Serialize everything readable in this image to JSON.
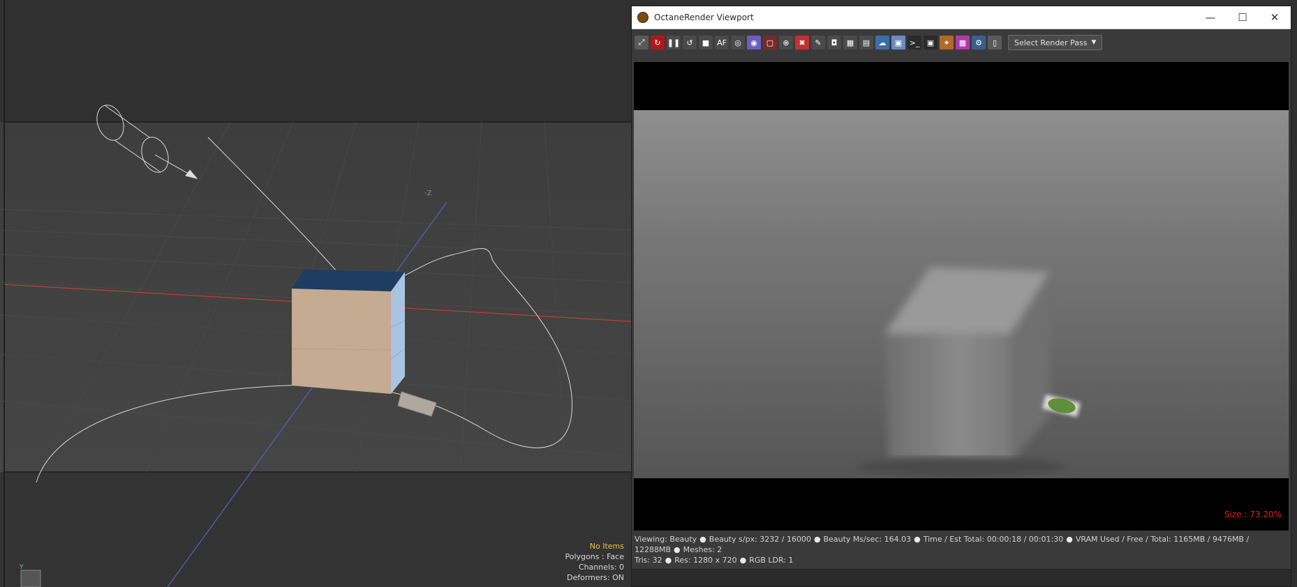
{
  "viewport": {
    "axis_label": "-Z",
    "info": {
      "selection": "No Items",
      "polygons": "Polygons : Face",
      "channels": "Channels: 0",
      "deformers": "Deformers: ON"
    },
    "gizmo_axis": "Y"
  },
  "octane": {
    "title": "OctaneRender Viewport",
    "controls": {
      "minimize": "—",
      "maximize": "☐",
      "close": "✕"
    },
    "toolbar": {
      "tools": [
        {
          "name": "expand-icon",
          "color": "#5a5a5a",
          "glyph": "⤢"
        },
        {
          "name": "start-render-icon",
          "color": "#b01818",
          "glyph": "↻"
        },
        {
          "name": "pause-icon",
          "color": "#4a4a4a",
          "glyph": "❚❚"
        },
        {
          "name": "restart-icon",
          "color": "#4a4a4a",
          "glyph": "↺"
        },
        {
          "name": "stop-icon",
          "color": "#4a4a4a",
          "glyph": "■"
        },
        {
          "name": "aa-icon",
          "color": "#4a4a4a",
          "glyph": "AF"
        },
        {
          "name": "settings-icon",
          "color": "#4a4a4a",
          "glyph": "◎"
        },
        {
          "name": "color-picker-icon",
          "color": "#6c5dbf",
          "glyph": "◉"
        },
        {
          "name": "region-icon",
          "color": "#7a2a2a",
          "glyph": "▢"
        },
        {
          "name": "focus-picker-icon",
          "color": "#4a4a4a",
          "glyph": "⊕"
        },
        {
          "name": "lock-icon",
          "color": "#c23030",
          "glyph": "✖"
        },
        {
          "name": "material-picker-icon",
          "color": "#4a4a4a",
          "glyph": "✎"
        },
        {
          "name": "camera-icon",
          "color": "#4a4a4a",
          "glyph": "◘"
        },
        {
          "name": "grid-icon",
          "color": "#4a4a4a",
          "glyph": "▦"
        },
        {
          "name": "save-icon",
          "color": "#4a4a4a",
          "glyph": "▤"
        },
        {
          "name": "cloud-icon",
          "color": "#3a6ea5",
          "glyph": "☁"
        },
        {
          "name": "cube-icon",
          "color": "#6a8cbf",
          "glyph": "▣"
        },
        {
          "name": "console-icon",
          "color": "#2a2a2a",
          "glyph": ">_"
        },
        {
          "name": "info-icon",
          "color": "#2a2a2a",
          "glyph": "▣"
        },
        {
          "name": "texture-icon",
          "color": "#b06a2a",
          "glyph": "✦"
        },
        {
          "name": "checker-icon",
          "color": "#b03aa8",
          "glyph": "▩"
        },
        {
          "name": "gear-icon",
          "color": "#3a5f8a",
          "glyph": "⚙"
        },
        {
          "name": "device-icon",
          "color": "#5a5a5a",
          "glyph": "▯"
        }
      ],
      "render_pass": "Select Render Pass"
    },
    "size_label": "Size : 73.20%",
    "status": {
      "line1": [
        "Viewing: Beauty",
        "Beauty s/px: 3232 / 16000",
        "Beauty Ms/sec: 164.03",
        "Time / Est Total: 00:00:18 / 00:01:30",
        "VRAM Used / Free / Total: 1165MB / 9476MB / 12288MB",
        "Meshes: 2"
      ],
      "line2": [
        "Tris: 32",
        "Res: 1280 x 720",
        "RGB LDR: 1"
      ]
    }
  }
}
